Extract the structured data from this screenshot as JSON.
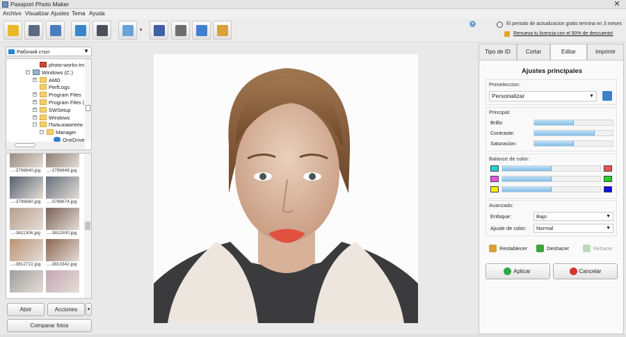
{
  "window": {
    "title": "Passport Photo Maker",
    "close": "✕"
  },
  "menu": [
    "Archivo",
    "Visualizar",
    "Ajustes",
    "Tema",
    "Ayuda"
  ],
  "toolbar": {
    "buttons": [
      {
        "name": "open-icon",
        "color": "#e8b82a"
      },
      {
        "name": "save-icon",
        "color": "#5a6a80"
      },
      {
        "name": "print-icon",
        "color": "#4a7cc0"
      },
      {
        "name": "person-icon",
        "color": "#3a86c9"
      },
      {
        "name": "camera-icon",
        "color": "#4a4f58"
      },
      {
        "name": "image-icon",
        "color": "#6aa3d8"
      },
      {
        "name": "book-icon",
        "color": "#3e5fa8"
      },
      {
        "name": "film-icon",
        "color": "#6e6e6e"
      },
      {
        "name": "globe-icon",
        "color": "#3f7fd0"
      },
      {
        "name": "gift-icon",
        "color": "#d8a13a"
      }
    ],
    "dropdown_glyph": "▾"
  },
  "notice": {
    "line1": "El periodo de actualizacion gratis termina en 3 meses",
    "line2": "Renueva tu licencia con el 50% de descuento!",
    "x": "×"
  },
  "left": {
    "folder_select": "Рабочий стол",
    "tree": [
      {
        "label": "photo-works-im",
        "indent": 48,
        "type": "file",
        "expander": ""
      },
      {
        "label": "Windows (C:)",
        "indent": 38,
        "type": "drive",
        "expander": "−"
      },
      {
        "label": "AMD",
        "indent": 48,
        "type": "folder",
        "expander": "+"
      },
      {
        "label": "PerfLogs",
        "indent": 48,
        "type": "folder",
        "expander": ""
      },
      {
        "label": "Program Files",
        "indent": 48,
        "type": "folder",
        "expander": "+"
      },
      {
        "label": "Program Files (",
        "indent": 48,
        "type": "folder",
        "expander": "+"
      },
      {
        "label": "SWSetup",
        "indent": 48,
        "type": "folder",
        "expander": "+"
      },
      {
        "label": "Windows",
        "indent": 48,
        "type": "folder",
        "expander": "+"
      },
      {
        "label": "Пользователи",
        "indent": 48,
        "type": "folder",
        "expander": "−"
      },
      {
        "label": "Manager",
        "indent": 58,
        "type": "folder",
        "expander": "−"
      },
      {
        "label": "OneDrive",
        "indent": 68,
        "type": "cloud",
        "expander": ""
      }
    ],
    "thumbs": [
      {
        "label": "...-3796640.jpg",
        "tone": "#8b7d72"
      },
      {
        "label": "...-3796649.jpg",
        "tone": "#7d6e65"
      },
      {
        "label": "...-3796660.jpg",
        "tone": "#55606e"
      },
      {
        "label": "...-3796674.jpg",
        "tone": "#65707c"
      },
      {
        "label": "...-3811306.jpg",
        "tone": "#b79f8c"
      },
      {
        "label": "...-3812500.jpg",
        "tone": "#7a6258"
      },
      {
        "label": "...-3812722.jpg",
        "tone": "#b99272"
      },
      {
        "label": "...-3813342.jpg",
        "tone": "#8c6651"
      },
      {
        "label": "",
        "tone": "#9e9e9e"
      },
      {
        "label": "",
        "tone": "#c3a6b5"
      }
    ],
    "btn_open": "Abrir",
    "btn_actions": "Acciones",
    "btn_compare": "Comparar fotos",
    "dd": "▾"
  },
  "tabs": [
    "Tipo de ID",
    "Cortar",
    "Editar",
    "Imprimir"
  ],
  "active_tab": "Editar",
  "panel": {
    "title": "Ajustes principales",
    "preselection_label": "Preseleccion:",
    "preselection_value": "Personalizar",
    "principal_label": "Principal:",
    "sliders": [
      {
        "label": "Brillo:",
        "fraction": 0.5
      },
      {
        "label": "Contraste:",
        "fraction": 0.77
      },
      {
        "label": "Saturacion:",
        "fraction": 0.5
      }
    ],
    "balance_label": "Balance de color:",
    "balance": [
      {
        "left": "#1fd3d3",
        "right": "#f05050",
        "fraction": 0.5
      },
      {
        "left": "#e455e4",
        "right": "#22d022",
        "fraction": 0.5
      },
      {
        "left": "#f0f000",
        "right": "#1010e8",
        "fraction": 0.5
      }
    ],
    "advanced_label": "Avanzado:",
    "focus_label": "Enfoque:",
    "focus_value": "Bajo",
    "colorfit_label": "Ajuste de color:",
    "colorfit_value": "Normal",
    "reset": "Restablecer",
    "undo": "Deshacer",
    "redo": "Rehacer",
    "apply": "Aplicar",
    "cancel": "Cancelar",
    "arrow": "▼"
  }
}
